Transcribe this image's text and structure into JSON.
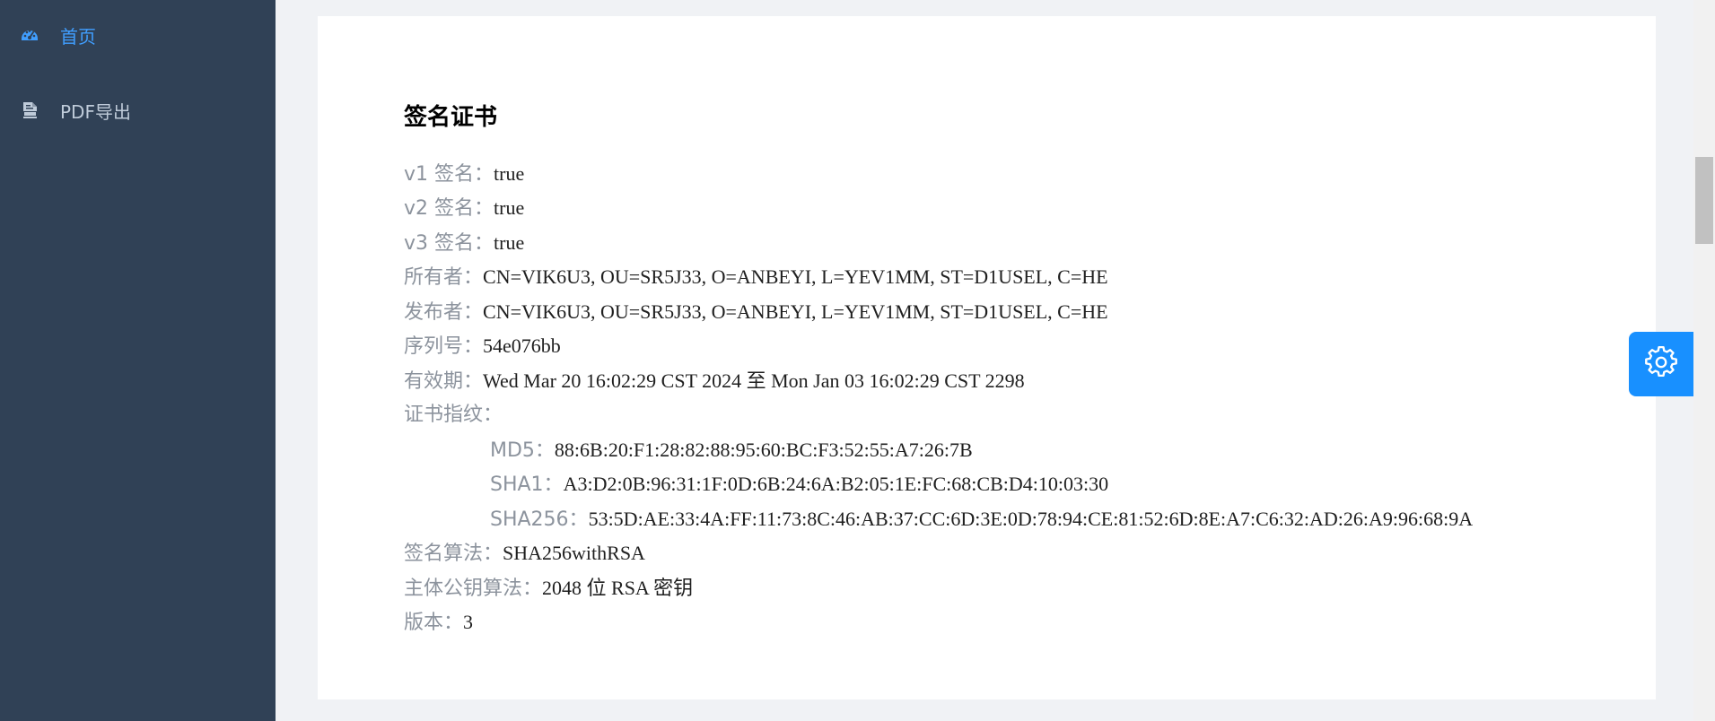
{
  "sidebar": {
    "items": [
      {
        "label": "首页",
        "icon": "dashboard-icon",
        "active": true
      },
      {
        "label": "PDF导出",
        "icon": "pdf-file-icon",
        "active": false
      }
    ]
  },
  "certificate": {
    "title": "签名证书",
    "v1_label": "v1 签名：",
    "v1_value": "true",
    "v2_label": "v2 签名：",
    "v2_value": "true",
    "v3_label": "v3 签名：",
    "v3_value": "true",
    "owner_label": "所有者：",
    "owner_value": "CN=VIK6U3, OU=SR5J33, O=ANBEYI, L=YEV1MM, ST=D1USEL, C=HE",
    "issuer_label": "发布者：",
    "issuer_value": "CN=VIK6U3, OU=SR5J33, O=ANBEYI, L=YEV1MM, ST=D1USEL, C=HE",
    "serial_label": "序列号：",
    "serial_value": "54e076bb",
    "validity_label": "有效期：",
    "validity_value": "Wed Mar 20 16:02:29 CST 2024 至 Mon Jan 03 16:02:29 CST 2298",
    "fingerprint_label": "证书指纹：",
    "md5_label": "MD5：",
    "md5_value": "88:6B:20:F1:28:82:88:95:60:BC:F3:52:55:A7:26:7B",
    "sha1_label": "SHA1：",
    "sha1_value": "A3:D2:0B:96:31:1F:0D:6B:24:6A:B2:05:1E:FC:68:CB:D4:10:03:30",
    "sha256_label": "SHA256：",
    "sha256_value": "53:5D:AE:33:4A:FF:11:73:8C:46:AB:37:CC:6D:3E:0D:78:94:CE:81:52:6D:8E:A7:C6:32:AD:26:A9:96:68:9A",
    "sig_alg_label": "签名算法：",
    "sig_alg_value": "SHA256withRSA",
    "pubkey_alg_label": "主体公钥算法：",
    "pubkey_alg_value": "2048 位 RSA 密钥",
    "version_label": "版本：",
    "version_value": "3"
  },
  "settings": {
    "icon": "gear-icon",
    "color": "#1890ff"
  },
  "colors": {
    "sidebar_bg": "#304156",
    "sidebar_text": "#bfcbd9",
    "active": "#409eff",
    "label": "#8c939d"
  }
}
